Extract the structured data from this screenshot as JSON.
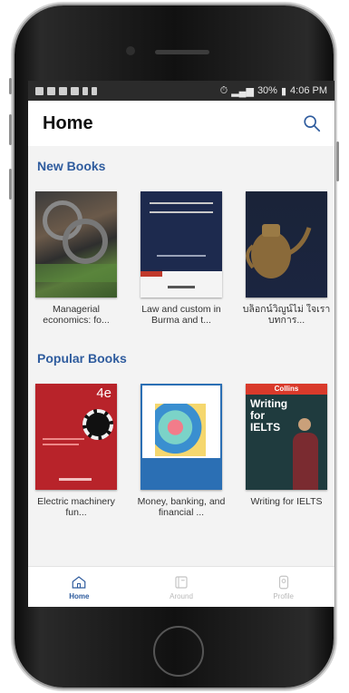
{
  "statusbar": {
    "battery": "30%",
    "time": "4:06 PM"
  },
  "appbar": {
    "title": "Home"
  },
  "sections": {
    "new": {
      "title": "New Books",
      "books": [
        {
          "caption": "Managerial economics: fo..."
        },
        {
          "caption": "Law and custom in Burma and t..."
        },
        {
          "caption": "บล็อกน์วิญูน์ไม่ ใจเรา บทการ..."
        }
      ]
    },
    "popular": {
      "title": "Popular Books",
      "books": [
        {
          "caption": "Electric machinery fun...",
          "edition": "4e"
        },
        {
          "caption": "Money, banking, and financial ..."
        },
        {
          "caption": "Writing for IELTS",
          "cover_brand": "Collins",
          "cover_title": "Writing for IELTS"
        }
      ]
    }
  },
  "nav": {
    "items": [
      {
        "label": "Home"
      },
      {
        "label": "Around"
      },
      {
        "label": "Profile"
      }
    ]
  },
  "colors": {
    "accent": "#2f5c9e"
  }
}
